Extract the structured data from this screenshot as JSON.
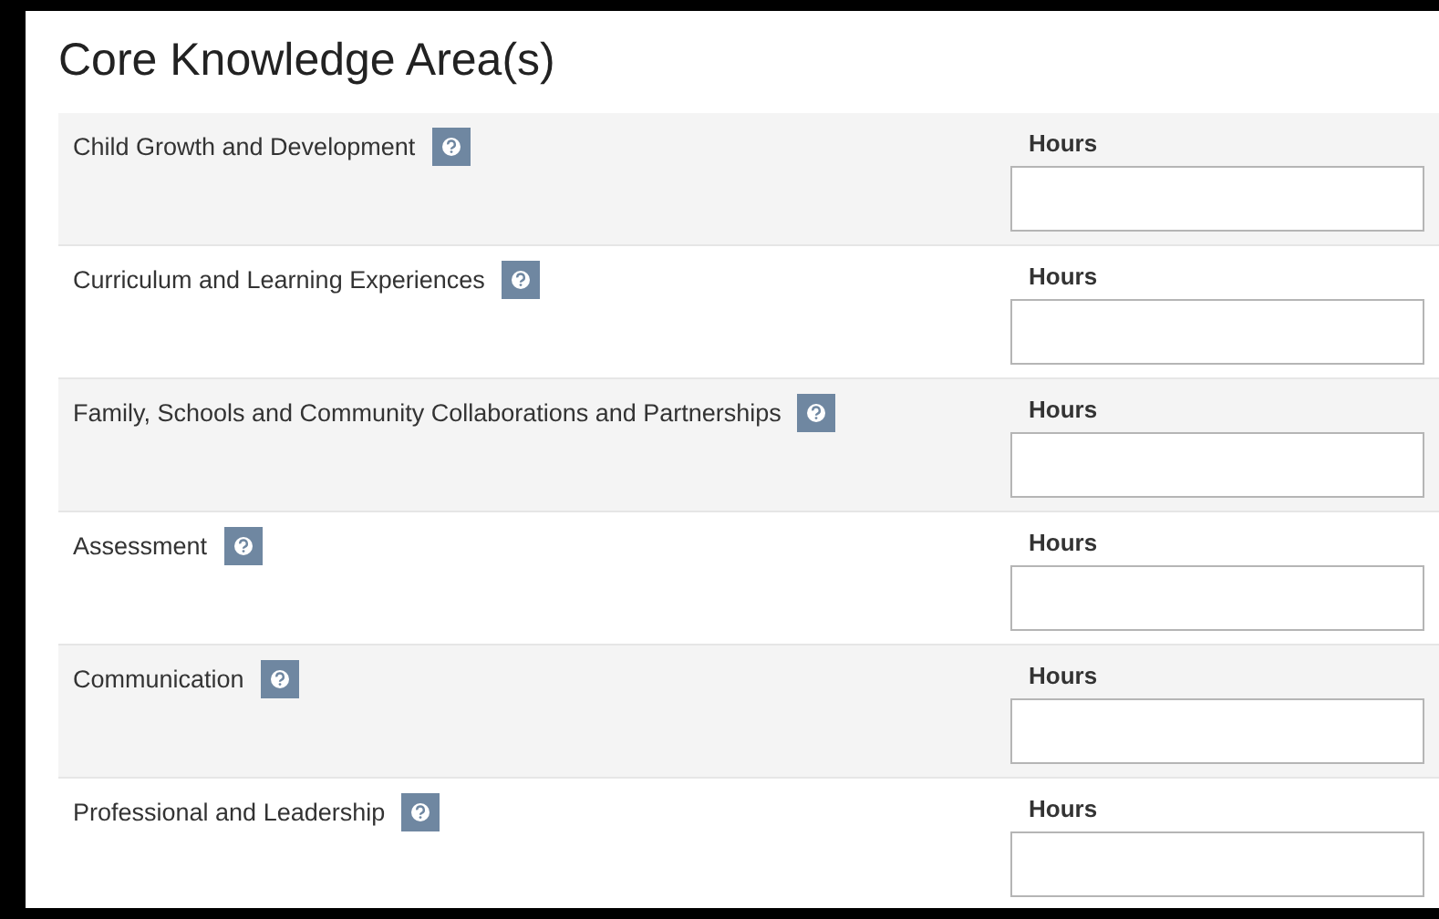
{
  "section": {
    "title": "Core Knowledge Area(s)"
  },
  "areas": [
    {
      "label": "Child Growth and Development",
      "field_label": "Hours"
    },
    {
      "label": "Curriculum and Learning Experiences",
      "field_label": "Hours"
    },
    {
      "label": "Family, Schools and Community Collaborations and Partnerships",
      "field_label": "Hours"
    },
    {
      "label": "Assessment",
      "field_label": "Hours"
    },
    {
      "label": "Communication",
      "field_label": "Hours"
    },
    {
      "label": "Professional and Leadership",
      "field_label": "Hours"
    }
  ]
}
